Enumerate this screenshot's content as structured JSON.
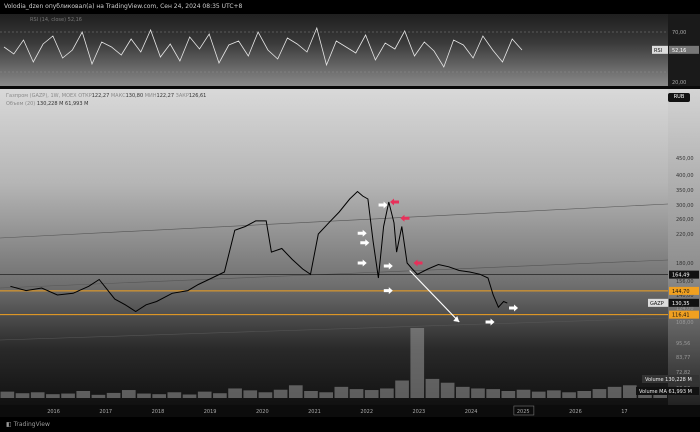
{
  "header": {
    "text": "Volodia_dzen опубликовал(а) на TradingView.com, Сен 24, 2024 08:35 UTC+8"
  },
  "footer": {
    "brand": "TradingView"
  },
  "controls": {
    "button_label": "RUB"
  },
  "legend": {
    "main": "Газпром (GAZP), 1W, MOEX",
    "open_label": "ОТКР",
    "open": "122,27",
    "high_label": "МАКС",
    "high": "130,80",
    "low_label": "МИН",
    "low": "122,27",
    "close_label": "ЗАКР",
    "close": "126,61",
    "volume_label": "Объем (20)",
    "volume": "130,228 M",
    "volume2": "61,993 M"
  },
  "rsi": {
    "label": "RSI (14, close)",
    "value": "52,16",
    "ticks": [
      "70,00",
      "20,00"
    ],
    "value_tag": "52,16",
    "tag_name": "RSI"
  },
  "price_axis": {
    "ticks": [
      "450,00",
      "400,00",
      "350,00",
      "300,00",
      "260,00",
      "220,00",
      "180,00",
      "156,00",
      "140,00",
      "124,00",
      "108,00",
      "95,56",
      "83,77",
      "72,82",
      "60,50"
    ],
    "current": {
      "label": "GAZP",
      "value": "130,35"
    },
    "level_high": "164,49",
    "level_mid": "144,70",
    "level_low": "116,41"
  },
  "volume_tags": {
    "volume_label": "Volume",
    "volume_value": "130,228 M",
    "ma_label": "Volume MA",
    "ma_value": "61,993 M"
  },
  "colors": {
    "support_line": "#f0a020",
    "price_line": "#000000",
    "marker_white": "#ffffff",
    "marker_pink": "#e8305a",
    "trend_line": "#555555",
    "volume_bar": "#9a9a9a"
  },
  "chart_data": {
    "type": "line",
    "title": "Газпром (GAZP), 1W, MOEX",
    "x": [
      "2016",
      "2017",
      "2018",
      "2019",
      "2020",
      "2021",
      "2022",
      "2023",
      "2024",
      "2025",
      "2026",
      "17"
    ],
    "series": [
      {
        "name": "GAZP",
        "values": [
          [
            2015.2,
            150
          ],
          [
            2015.5,
            145
          ],
          [
            2015.8,
            148
          ],
          [
            2016.1,
            140
          ],
          [
            2016.4,
            142
          ],
          [
            2016.7,
            150
          ],
          [
            2016.9,
            158
          ],
          [
            2017.2,
            135
          ],
          [
            2017.4,
            128
          ],
          [
            2017.6,
            120
          ],
          [
            2017.8,
            128
          ],
          [
            2018.0,
            132
          ],
          [
            2018.3,
            142
          ],
          [
            2018.6,
            145
          ],
          [
            2018.8,
            152
          ],
          [
            2019.0,
            158
          ],
          [
            2019.3,
            168
          ],
          [
            2019.5,
            230
          ],
          [
            2019.7,
            240
          ],
          [
            2019.9,
            255
          ],
          [
            2020.1,
            255
          ],
          [
            2020.2,
            195
          ],
          [
            2020.4,
            200
          ],
          [
            2020.6,
            185
          ],
          [
            2020.8,
            172
          ],
          [
            2020.95,
            165
          ],
          [
            2021.1,
            220
          ],
          [
            2021.3,
            250
          ],
          [
            2021.5,
            280
          ],
          [
            2021.7,
            320
          ],
          [
            2021.85,
            345
          ],
          [
            2021.95,
            330
          ],
          [
            2022.05,
            320
          ],
          [
            2022.15,
            210
          ],
          [
            2022.25,
            160
          ],
          [
            2022.35,
            240
          ],
          [
            2022.45,
            310
          ],
          [
            2022.55,
            250
          ],
          [
            2022.6,
            195
          ],
          [
            2022.7,
            240
          ],
          [
            2022.8,
            180
          ],
          [
            2022.9,
            172
          ],
          [
            2023.0,
            165
          ],
          [
            2023.2,
            172
          ],
          [
            2023.4,
            178
          ],
          [
            2023.6,
            175
          ],
          [
            2023.8,
            170
          ],
          [
            2024.0,
            168
          ],
          [
            2024.2,
            165
          ],
          [
            2024.35,
            160
          ],
          [
            2024.45,
            140
          ],
          [
            2024.55,
            125
          ],
          [
            2024.65,
            132
          ],
          [
            2024.72,
            130
          ]
        ]
      }
    ],
    "levels": [
      {
        "name": "164,49",
        "value": 164.49
      },
      {
        "name": "144,70",
        "value": 144.7
      },
      {
        "name": "116,41",
        "value": 116.41
      }
    ],
    "rsi_series": [
      55,
      48,
      62,
      40,
      58,
      66,
      44,
      52,
      70,
      38,
      60,
      55,
      47,
      63,
      50,
      72,
      45,
      58,
      41,
      65,
      53,
      68,
      39,
      57,
      61,
      46,
      70,
      52,
      43,
      64,
      58,
      50,
      74,
      37,
      61,
      55,
      49,
      67,
      42,
      59,
      53,
      71,
      46,
      60,
      51,
      35,
      62,
      57,
      44,
      66,
      52,
      40,
      63,
      52
    ],
    "volume": [
      20,
      15,
      18,
      12,
      14,
      22,
      10,
      16,
      25,
      14,
      12,
      18,
      11,
      20,
      15,
      30,
      24,
      18,
      26,
      40,
      22,
      18,
      35,
      28,
      25,
      30,
      55,
      220,
      60,
      48,
      35,
      30,
      28,
      22,
      26,
      20,
      24,
      18,
      22,
      28,
      35,
      40,
      30,
      25
    ],
    "ylim": [
      60.5,
      450
    ],
    "grid": false
  }
}
